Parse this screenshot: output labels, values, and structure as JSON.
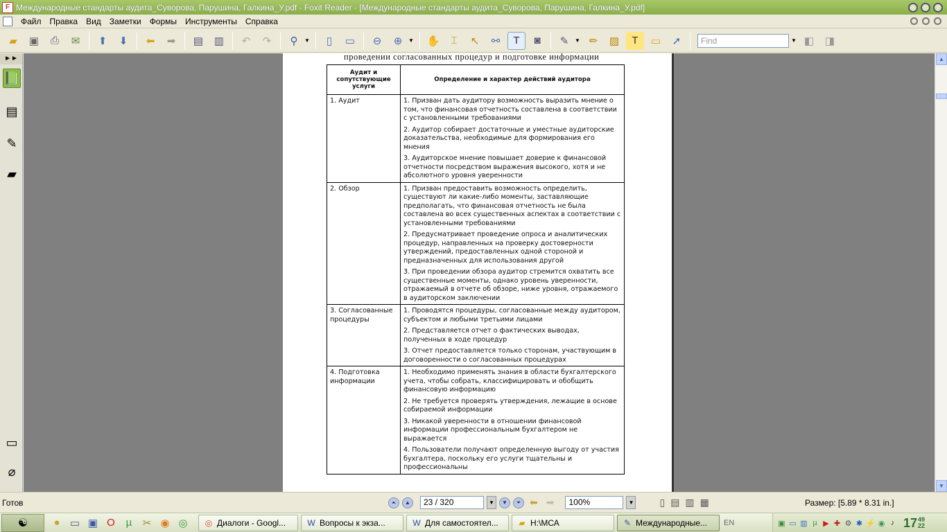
{
  "window": {
    "title": "Международные стандарты аудита_Суворова, Парушина, Галкина_У.pdf - Foxit Reader - [Международные стандарты аудита_Суворова, Парушина, Галкина_У.pdf]"
  },
  "menu": {
    "items": [
      "Файл",
      "Правка",
      "Вид",
      "Заметки",
      "Формы",
      "Инструменты",
      "Справка"
    ]
  },
  "toolbar": {
    "icons": [
      "open-folder-icon",
      "save-icon",
      "print-icon",
      "email-icon",
      "up-arrow-icon",
      "down-arrow-icon",
      "back-arrow-icon",
      "forward-arrow-icon",
      "page-insert-icon",
      "page-extract-icon",
      "undo-icon",
      "redo-icon",
      "zoom-icon",
      "fit-page-icon",
      "fit-width-icon",
      "zoom-out-icon",
      "zoom-in-icon",
      "hand-icon",
      "select-text-icon",
      "select-arrow-icon",
      "find-text-icon",
      "typewriter-icon",
      "snapshot-icon",
      "pen-icon",
      "pencil-icon",
      "highlight-icon",
      "textbox-icon",
      "note-icon",
      "arrow-icon"
    ],
    "find_placeholder": "Find"
  },
  "nav_panel": {
    "header_symbol": "►►"
  },
  "document": {
    "header_line": "проведении согласованных процедур и подготовке информации",
    "table": {
      "col1_header": "Аудит и сопутствующие услуги",
      "col2_header": "Определение и характер действий аудитора",
      "rows": [
        {
          "service": "1. Аудит",
          "items": [
            "1. Призван дать аудитору возможность выразить мнение о том, что финансовая отчетность составлена в соответствии с установленными требованиями",
            "2. Аудитор собирает достаточные и уместные аудиторские доказательства, необходимые для формирования его мнения",
            "3. Аудиторское мнение повышает доверие к финансовой отчетности посредством выражения высокого, хотя и не абсолютного уровня уверенности"
          ]
        },
        {
          "service": "2. Обзор",
          "items": [
            "1. Призван предоставить возможность определить, существуют ли какие-либо моменты, заставляющие предполагать, что финансовая отчетность не была составлена во всех существенных аспектах в соответствии с установленными требованиями",
            "2. Предусматривает проведение опроса и аналитических процедур, направленных на проверку достоверности утверждений, предоставленных одной стороной и предназначенных для использования другой",
            "3. При проведении обзора аудитор стремится охватить все существенные моменты, однако уровень уверенности, отражаемый в отчете об обзоре, ниже уровня, отражаемого в аудиторском заключении"
          ]
        },
        {
          "service": "3. Согласованные процедуры",
          "items": [
            "1. Проводятся процедуры, согласованные между аудитором, субъектом и любыми третьими лицами",
            "2. Представляется отчет о фактических выводах, полученных в ходе процедур",
            "3. Отчет предоставляется только сторонам, участвующим в договоренности о согласованных процедурах"
          ]
        },
        {
          "service": "4. Подготовка информации",
          "items": [
            "1. Необходимо применять знания в области бухгалтерского учета, чтобы собрать, классифицировать и обобщить финансовую информацию",
            "2. Не требуется проверять утверждения, лежащие в основе собираемой информации",
            "3. Никакой уверенности в отношении финансовой информации профессиональным бухгалтером не выражается",
            "4. Пользователи получают определенную выгоду от участия бухгалтера, поскольку его услуги тщательны и профессиональны"
          ]
        }
      ]
    }
  },
  "status": {
    "ready": "Готов",
    "page_value": "23 / 320",
    "zoom_value": "100%",
    "size": "Размер: [5.89 * 8.31 in.]"
  },
  "taskbar": {
    "tasks": [
      {
        "label": "Диалоги - Googl...",
        "icon": "chrome-icon",
        "active": false
      },
      {
        "label": "Вопросы к экза...",
        "icon": "word-icon",
        "active": false
      },
      {
        "label": "Для самостоятел...",
        "icon": "word-icon",
        "active": false
      },
      {
        "label": "H:\\МСА",
        "icon": "folder-icon",
        "active": false
      },
      {
        "label": "Международные...",
        "icon": "foxit-icon",
        "active": true
      }
    ],
    "lang": "EN",
    "clock_time": "17",
    "clock_min": "49",
    "clock_sec": "22"
  }
}
